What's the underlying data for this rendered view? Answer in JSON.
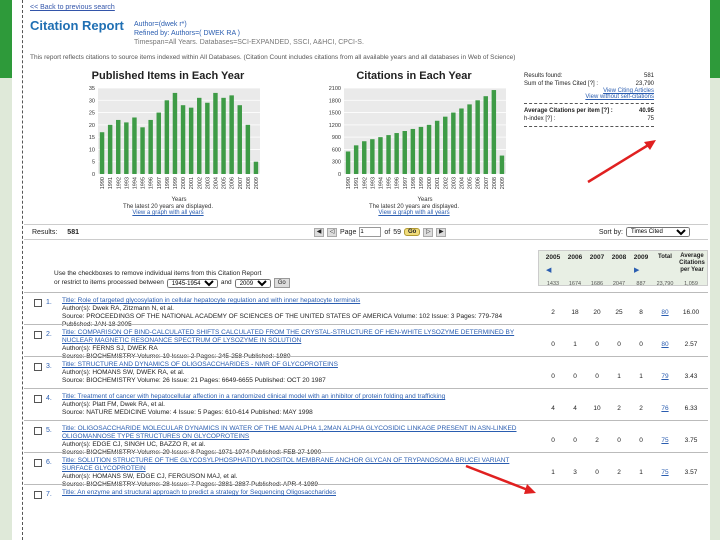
{
  "back_link": "<< Back to previous search",
  "title": "Citation Report",
  "query": {
    "line1": "Author=(dwek r*)",
    "line2": "Refined by: Authors=( DWEK RA )",
    "line3": "Timespan=All Years. Databases=SCI-EXPANDED, SSCI, A&HCI, CPCI-S."
  },
  "description": "This report reflects citations to source items indexed within All Databases. (Citation Count includes citations from all available years and all databases in Web of Science)",
  "published_chart": {
    "title": "Published Items in Each Year",
    "note": "The latest 20 years are displayed.",
    "link": "View a graph with all years"
  },
  "citations_chart": {
    "title": "Citations in Each Year",
    "note": "The latest 20 years are displayed.",
    "link": "View a graph with all years"
  },
  "chart_data": [
    {
      "type": "bar",
      "title": "Published Items in Each Year",
      "categories": [
        "1990",
        "1991",
        "1992",
        "1993",
        "1994",
        "1995",
        "1996",
        "1997",
        "1998",
        "1999",
        "2000",
        "2001",
        "2002",
        "2003",
        "2004",
        "2005",
        "2006",
        "2007",
        "2008",
        "2009"
      ],
      "values": [
        17,
        20,
        22,
        21,
        23,
        19,
        22,
        25,
        30,
        33,
        28,
        27,
        31,
        29,
        33,
        31,
        32,
        28,
        20,
        5
      ],
      "xlabel": "Years",
      "ylim": [
        0,
        35
      ],
      "yticks": [
        0,
        5,
        10,
        15,
        20,
        25,
        30,
        35
      ],
      "grid": true,
      "color": "#3e9b46"
    },
    {
      "type": "bar",
      "title": "Citations in Each Year",
      "categories": [
        "1990",
        "1991",
        "1992",
        "1993",
        "1994",
        "1995",
        "1996",
        "1997",
        "1998",
        "1999",
        "2000",
        "2001",
        "2002",
        "2003",
        "2004",
        "2005",
        "2006",
        "2007",
        "2008",
        "2009"
      ],
      "values": [
        550,
        700,
        800,
        850,
        900,
        950,
        1000,
        1050,
        1100,
        1150,
        1200,
        1300,
        1400,
        1500,
        1600,
        1700,
        1800,
        1900,
        2050,
        450
      ],
      "xlabel": "Years",
      "ylim": [
        0,
        2100
      ],
      "yticks": [
        0,
        300,
        600,
        900,
        1200,
        1500,
        1800,
        2100
      ],
      "grid": true,
      "color": "#3e9b46"
    }
  ],
  "summary": {
    "results_found_label": "Results found:",
    "results_found_value": "581",
    "sum_label": "Sum of the Times Cited [?] :",
    "sum_value": "23,790",
    "view_citing": "View Citing Articles",
    "view_without_self": "View without self-citations",
    "avg_label": "Average Citations per item [?] :",
    "avg_value": "40.95",
    "hindex_label": "h-index [?] :",
    "hindex_value": "75"
  },
  "results_bar": {
    "label": "Results:",
    "count": "581",
    "page_label": "Page",
    "page_value": "1",
    "of_label": "of",
    "total_pages": "59",
    "go": "Go",
    "sort_label": "Sort by:",
    "sort_value": "Times Cited"
  },
  "filter": {
    "line1": "Use the checkboxes to remove individual items from this Citation Report",
    "line2": "or restrict to items processed between",
    "from": "1945-1954",
    "and_label": "and",
    "to": "2009",
    "go": "Go"
  },
  "grid": {
    "years": [
      "2005",
      "2006",
      "2007",
      "2008",
      "2009"
    ],
    "total_label": "Total",
    "avg_label": "Average Citations per Year",
    "totals": [
      "1433",
      "1674",
      "1686",
      "2047",
      "887",
      "23,790",
      "1,059"
    ]
  },
  "records": [
    {
      "num": "1.",
      "title": "Title: Role of targeted glycosylation in cellular hepatocyte regulation and with inner hepatocyte terminals",
      "authors": "Author(s): Dwek RA, Zitzmann N, et al.",
      "source": "Source: PROCEEDINGS OF THE NATIONAL ACADEMY OF SCIENCES OF THE UNITED STATES OF AMERICA  Volume: 102  Issue: 3  Pages: 779-784  Published: JAN 18 2005",
      "cells": [
        "2",
        "18",
        "20",
        "25",
        "8",
        "80",
        "16.00"
      ]
    },
    {
      "num": "2.",
      "title": "Title: COMPARISON OF BIND-CALCULATED SHIFTS CALCULATED FROM THE CRYSTAL-STRUCTURE OF HEN-WHITE LYSOZYME DETERMINED BY NUCLEAR MAGNETIC RESONANCE SPECTRUM OF LYSOZYME IN SOLUTION",
      "authors": "Author(s): FERNS SJ, DWEK RA",
      "source": "Source: BIOCHEMISTRY  Volume: 19  Issue: 2  Pages: 245-258  Published: 1980",
      "cells": [
        "0",
        "1",
        "0",
        "0",
        "0",
        "80",
        "2.57"
      ]
    },
    {
      "num": "3.",
      "title": "Title: STRUCTURE AND DYNAMICS OF OLIGOSACCHARIDES - NMR OF GLYCOPROTEINS",
      "authors": "Author(s): HOMANS SW, DWEK RA, et al.",
      "source": "Source: BIOCHEMISTRY  Volume: 26  Issue: 21  Pages: 6649-6655  Published: OCT 20 1987",
      "cells": [
        "0",
        "0",
        "0",
        "1",
        "1",
        "79",
        "3.43"
      ]
    },
    {
      "num": "4.",
      "title": "Title: Treatment of cancer with hepatocellular affection in a randomized clinical model with an inhibitor of protein folding and trafficking",
      "authors": "Author(s): Platt FM, Dwek RA, et al.",
      "source": "Source: NATURE MEDICINE  Volume: 4  Issue: 5  Pages: 610-614  Published: MAY 1998",
      "cells": [
        "4",
        "4",
        "10",
        "2",
        "2",
        "76",
        "6.33"
      ]
    },
    {
      "num": "5.",
      "title": "Title: OLIGOSACCHARIDE MOLECULAR DYNAMICS IN WATER OF THE MAN ALPHA 1,2MAN ALPHA GLYCOSIDIC LINKAGE PRESENT IN ASN-LINKED OLIGOMANNOSE TYPE STRUCTURES ON GLYCOPROTEINS",
      "authors": "Author(s): EDGE CJ, SINGH UC, BAZZO R, et al.",
      "source": "Source: BIOCHEMISTRY  Volume: 29  Issue: 8  Pages: 1971-1974  Published: FEB 27 1990",
      "cells": [
        "0",
        "0",
        "2",
        "0",
        "0",
        "75",
        "3.75"
      ]
    },
    {
      "num": "6.",
      "title": "Title: SOLUTION STRUCTURE OF THE GLYCOSYLPHOSPHATIDYLINOSITOL MEMBRANE ANCHOR GLYCAN OF TRYPANOSOMA BRUCEI VARIANT SURFACE GLYCOPROTEIN",
      "authors": "Author(s): HOMANS SW, EDGE CJ, FERGUSON MAJ, et al.",
      "source": "Source: BIOCHEMISTRY  Volume: 28  Issue: 7  Pages: 2881-2887  Published: APR 4 1989",
      "cells": [
        "1",
        "3",
        "0",
        "2",
        "1",
        "75",
        "3.57"
      ]
    },
    {
      "num": "7.",
      "title": "Title: An enzyme and structural approach to predict a strategy for Sequencing Oligosaccharides",
      "authors": "",
      "source": "",
      "cells": [
        "",
        "",
        "",
        "",
        "",
        "",
        ""
      ]
    }
  ]
}
